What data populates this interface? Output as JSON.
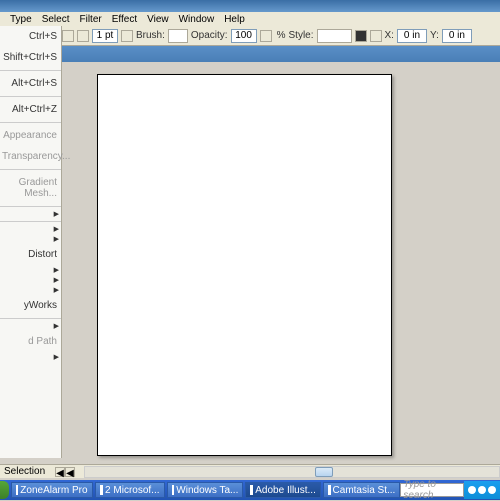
{
  "menus": {
    "type": "Type",
    "select": "Select",
    "filter": "Filter",
    "effect": "Effect",
    "view": "View",
    "window": "Window",
    "help": "Help"
  },
  "toolbar": {
    "stroke_value": "1 pt",
    "brush_label": "Brush:",
    "opacity_label": "Opacity:",
    "opacity_value": "100",
    "style_label": "Style:",
    "x_label": "X:",
    "y_label": "Y:",
    "x_value": "0 in",
    "y_value": "0 in"
  },
  "context_menu": {
    "shortcut1": "Ctrl+S",
    "shortcut2": "Shift+Ctrl+S",
    "shortcut3": "Alt+Ctrl+S",
    "shortcut4": "Alt+Ctrl+Z",
    "appearance": "Appearance",
    "transparency": "Transparency...",
    "gradient": "Gradient Mesh...",
    "distort": "Distort",
    "works": "yWorks",
    "path": "d Path"
  },
  "status": {
    "tool": "Selection"
  },
  "taskbar": {
    "app1": "ZoneAlarm Pro",
    "app2": "2 Microsof...",
    "app3": "Windows Ta...",
    "app4": "Adobe Illust...",
    "app5": "Camtasia St...",
    "search": "Type to search"
  }
}
